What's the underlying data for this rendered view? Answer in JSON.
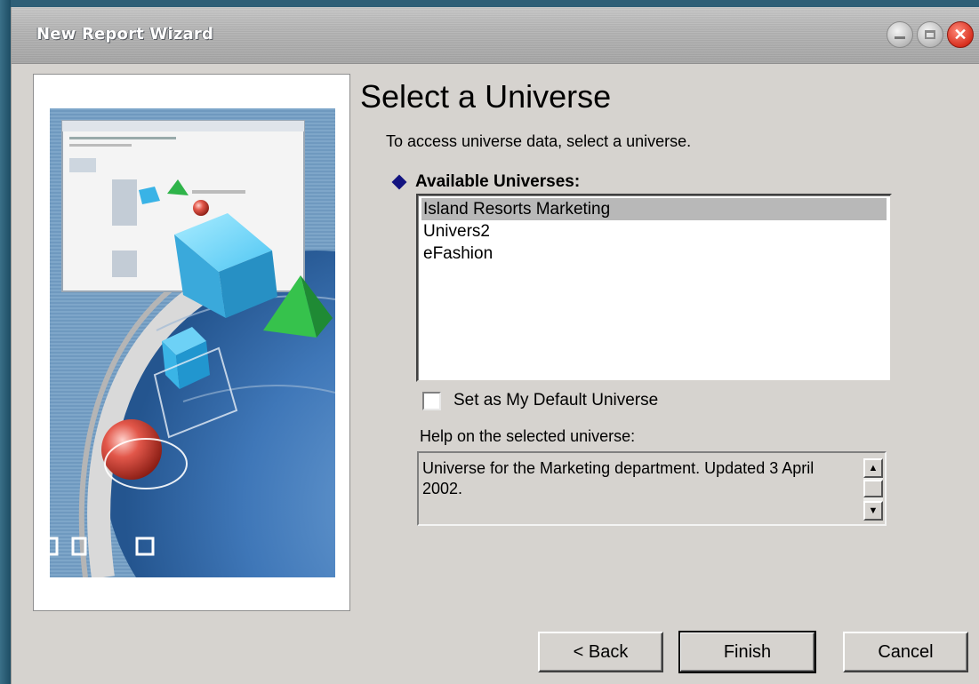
{
  "window": {
    "title": "New Report Wizard"
  },
  "heading": "Select a Universe",
  "intro": "To access universe data, select a universe.",
  "available": {
    "label": "Available Universes:",
    "items": [
      {
        "label": "Island Resorts Marketing",
        "selected": true
      },
      {
        "label": "Univers2",
        "selected": false
      },
      {
        "label": "eFashion",
        "selected": false
      }
    ]
  },
  "default_checkbox": {
    "label": "Set as My Default Universe",
    "checked": false
  },
  "help": {
    "label": "Help on the selected universe:",
    "text": "Universe for the Marketing department. Updated 3 April 2002."
  },
  "buttons": {
    "back": "< Back",
    "finish": "Finish",
    "cancel": "Cancel"
  },
  "colors": {
    "desktop": "#2e5f77",
    "dialog": "#d6d3cf",
    "selection": "#b8b8b8",
    "diamond": "#131380",
    "close": "#d8301f"
  },
  "icons": [
    "minimize-icon",
    "maximize-icon",
    "close-icon",
    "diamond-bullet-icon",
    "scroll-up-icon",
    "scroll-down-icon"
  ]
}
